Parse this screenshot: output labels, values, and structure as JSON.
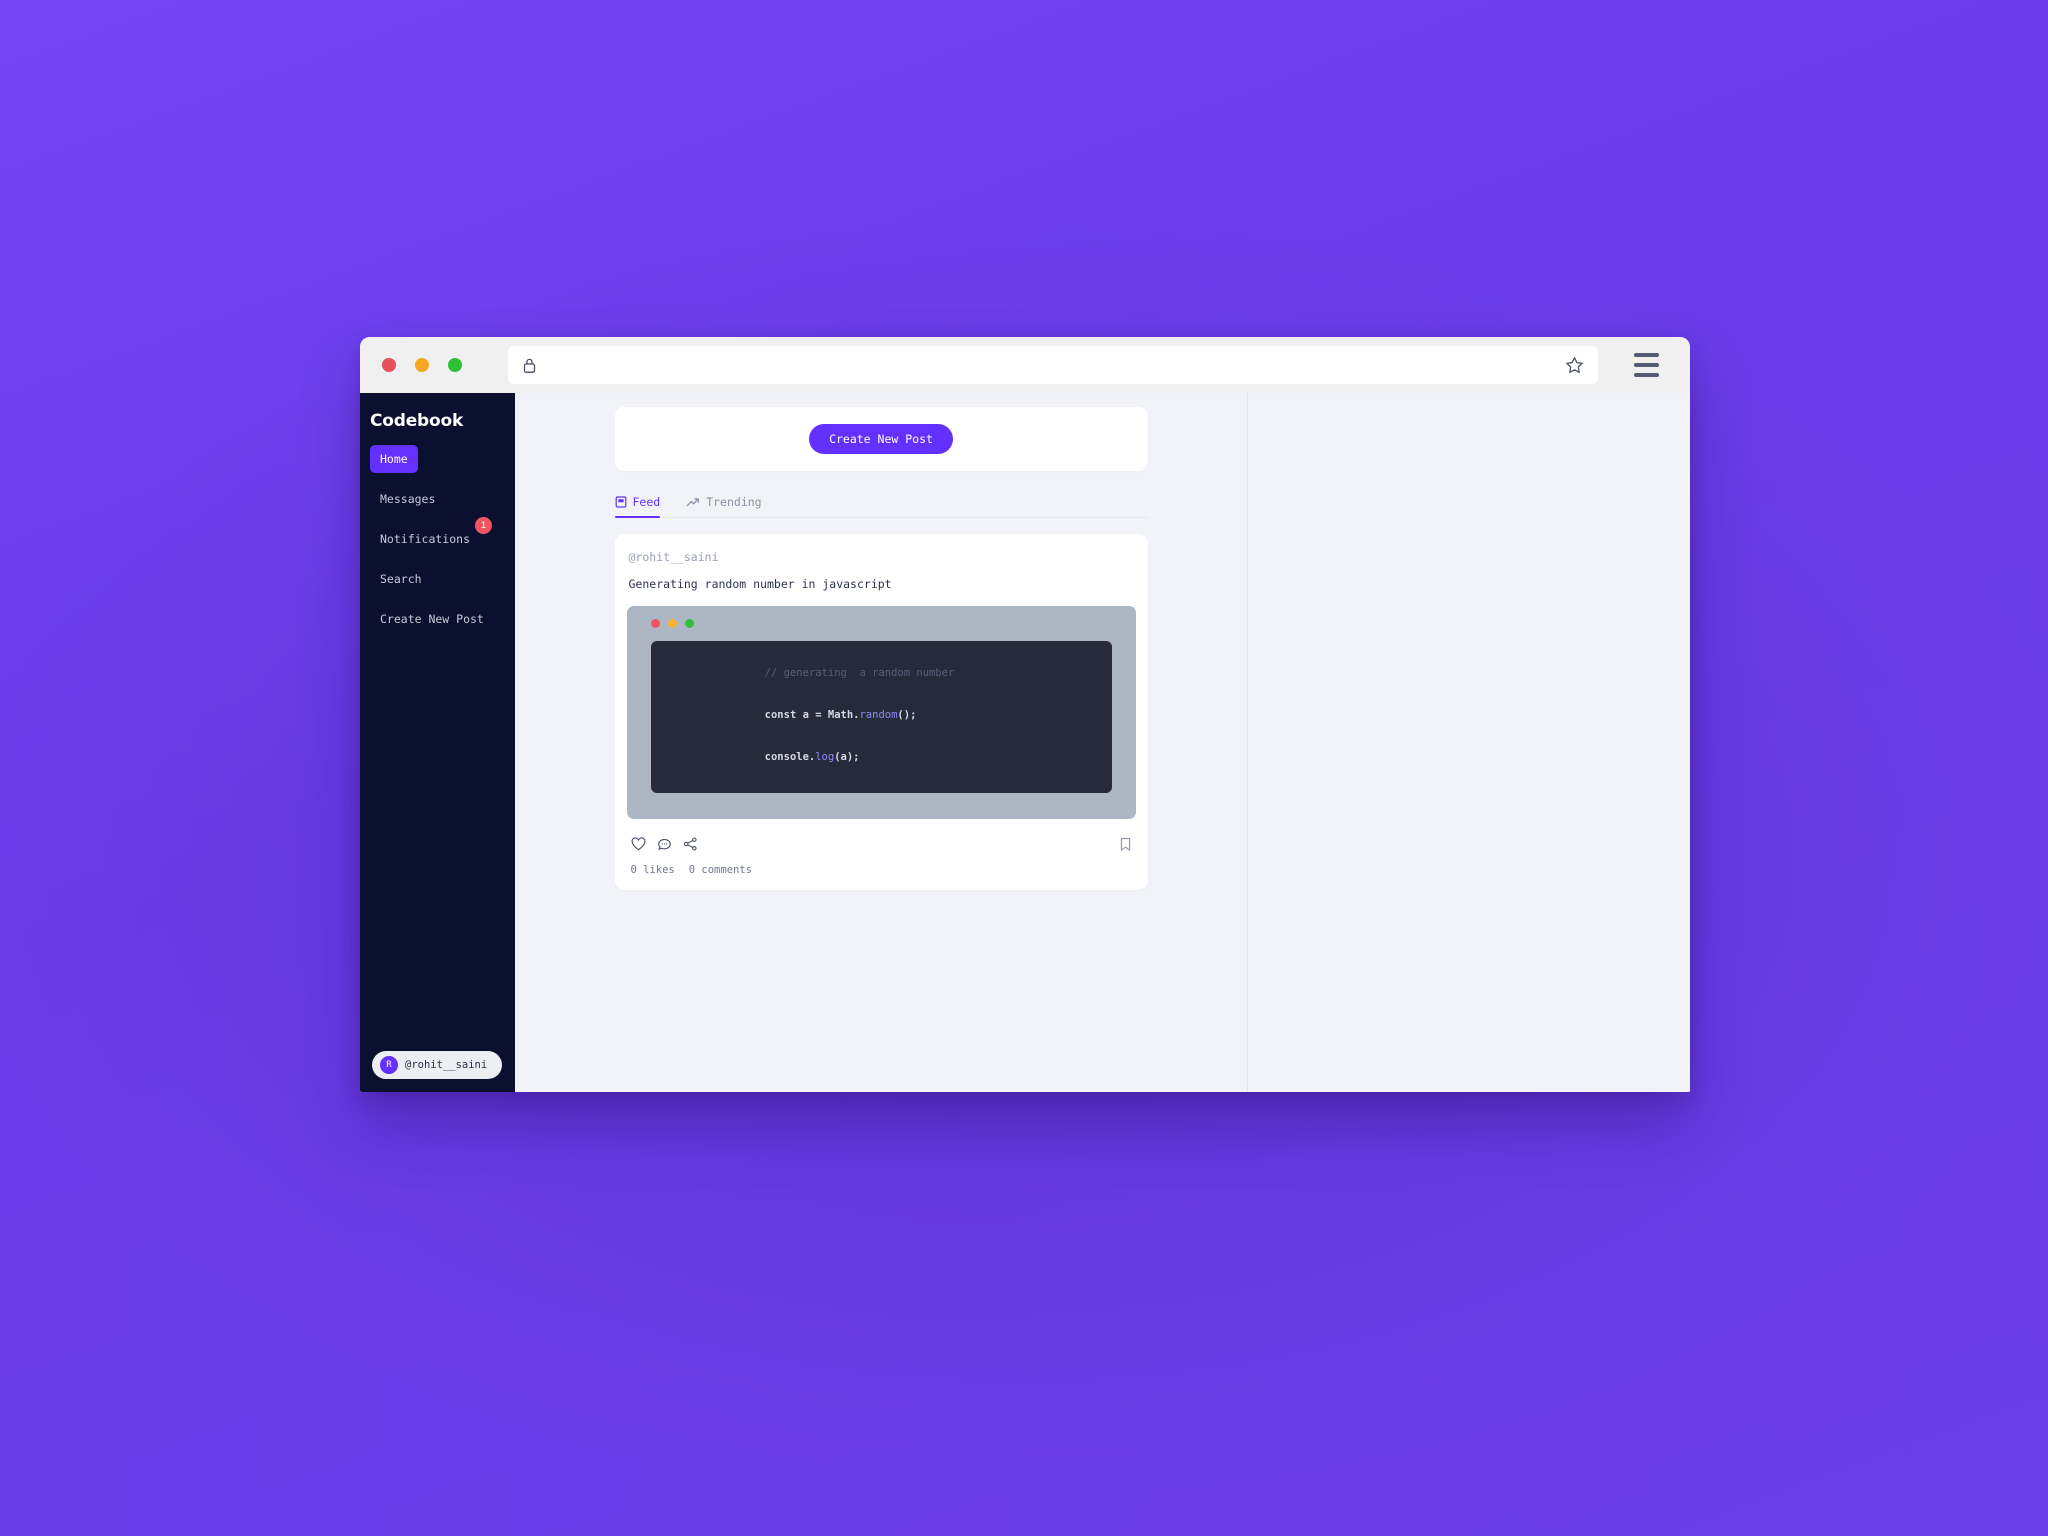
{
  "theme": {
    "backdrop_purple": "#6b3fe8",
    "accent_purple": "#6430ff",
    "sidebar_dark": "#0b1030",
    "content_bg": "#f2f3f8",
    "card_white": "#ffffff",
    "code_window_gray": "#adb7c4",
    "code_body_dark": "#262a3b",
    "badge_red": "#f05560"
  },
  "browser": {
    "traffic_lights": [
      {
        "name": "close",
        "color": "#e8505b"
      },
      {
        "name": "minimize",
        "color": "#f5a623"
      },
      {
        "name": "maximize",
        "color": "#2fbf34"
      }
    ],
    "url_value": "",
    "url_placeholder": "",
    "lock_icon": "lock-icon",
    "star_icon": "star-icon",
    "menu_icon": "hamburger-menu-icon"
  },
  "sidebar": {
    "brand": "Codebook",
    "items": [
      {
        "label": "Home",
        "active": true,
        "badge": null
      },
      {
        "label": "Messages",
        "active": false,
        "badge": null
      },
      {
        "label": "Notifications",
        "active": false,
        "badge": "1"
      },
      {
        "label": "Search",
        "active": false,
        "badge": null
      },
      {
        "label": "Create New Post",
        "active": false,
        "badge": null
      }
    ],
    "user": {
      "avatar_initial": "R",
      "handle": "@rohit__saini"
    }
  },
  "main": {
    "create_post_button": "Create New Post",
    "tabs": [
      {
        "label": "Feed",
        "icon": "feed-icon",
        "active": true
      },
      {
        "label": "Trending",
        "icon": "trending-up-icon",
        "active": false
      }
    ],
    "post": {
      "author": "@rohit__saini",
      "title": "Generating random number in javascript",
      "code": {
        "window_dots": [
          {
            "name": "close",
            "color": "#f05560"
          },
          {
            "name": "minimize",
            "color": "#f8b131"
          },
          {
            "name": "maximize",
            "color": "#33c13c"
          }
        ],
        "line1_comment": "// generating  a random number",
        "line2_kw": "const",
        "line2_rest": " a = ",
        "line2_obj": "Math.",
        "line2_fn": "random",
        "line2_tail": "();",
        "line3_obj": "console.",
        "line3_fn": "log",
        "line3_tail": "(a);"
      },
      "actions": [
        {
          "name": "like-icon"
        },
        {
          "name": "comment-icon"
        },
        {
          "name": "share-icon"
        },
        {
          "name": "bookmark-icon"
        }
      ],
      "likes_text": "0 likes",
      "comments_text": "0 comments"
    }
  }
}
